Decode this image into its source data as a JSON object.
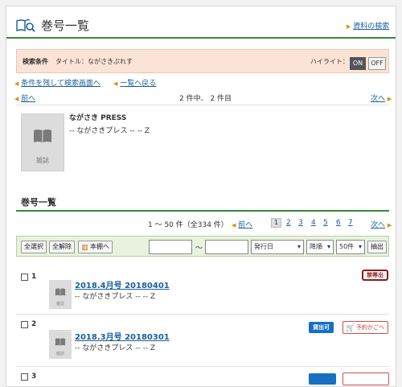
{
  "header": {
    "title": "巻号一覧",
    "material_search_link": "資料の検索"
  },
  "conditions": {
    "label": "検索条件",
    "text": "タイトル：ながさきぷれす",
    "highlight_label": "ハイライト：",
    "on_label": "ON",
    "off_label": "OFF"
  },
  "nav": {
    "back_to_search": "条件を残して検索画面へ",
    "back_to_list": "一覧へ戻る",
    "prev": "前へ",
    "next": "次へ",
    "count_text": "2 件中、 2 件目"
  },
  "record": {
    "title": "ながさき PRESS",
    "subtitle": "-- ながさきプレス -- -- Z",
    "cover_label": "雑誌"
  },
  "issues": {
    "heading": "巻号一覧",
    "range_text": "1 〜 50 件（全334 件）",
    "prev": "前へ",
    "next": "次へ",
    "pages": [
      "1",
      "2",
      "3",
      "4",
      "5",
      "6",
      "7"
    ],
    "toolbar": {
      "select_all": "全選択",
      "deselect_all": "全解除",
      "bookshelf": "本棚へ",
      "tilde": "〜",
      "sort_field": "発行日",
      "sort_order": "降順",
      "per_page": "50件",
      "extract": "抽出"
    },
    "items": [
      {
        "num": "1",
        "title": "2018.4月号 20180401",
        "sub": "-- ながさきプレス -- -- Z",
        "thumb_label": "雑誌",
        "status": "禁帯出"
      },
      {
        "num": "2",
        "title": "2018.3月号 20180301",
        "sub": "-- ながさきプレス -- -- Z",
        "thumb_label": "雑誌",
        "status": "貸出可",
        "cart": "予約かごへ"
      },
      {
        "num": "3"
      }
    ]
  },
  "colors": {
    "accent_green": "#3a8a3a",
    "link_blue": "#1a5e9e",
    "badge_blue": "#1570c4",
    "badge_red": "#8b1a1a"
  }
}
